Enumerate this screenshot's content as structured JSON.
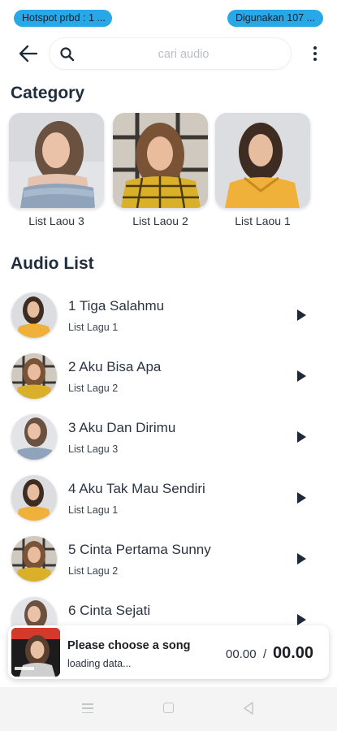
{
  "status": {
    "hotspot_text": "Hotspot prbd : 1 ...",
    "usage_text": "Digunakan 107 ..."
  },
  "header": {
    "back_icon": "arrow-left-icon",
    "search_icon": "search-icon",
    "search_placeholder": "cari audio",
    "search_value": "",
    "menu_icon": "more-vertical-icon"
  },
  "category": {
    "title": "Category",
    "items": [
      {
        "label": "List Laou 3"
      },
      {
        "label": "List Laou 2"
      },
      {
        "label": "List Laou 1"
      }
    ]
  },
  "audio_list": {
    "title": "Audio List",
    "items": [
      {
        "title": "1 Tiga Salahmu",
        "subtitle": "List Lagu 1"
      },
      {
        "title": "2 Aku Bisa Apa",
        "subtitle": "List Lagu 2"
      },
      {
        "title": "3 Aku Dan Dirimu",
        "subtitle": "List Lagu 3"
      },
      {
        "title": "4 Aku Tak Mau Sendiri",
        "subtitle": "List Lagu 1"
      },
      {
        "title": "5 Cinta Pertama Sunny",
        "subtitle": "List Lagu 2"
      },
      {
        "title": "6 Cinta Sejati",
        "subtitle": ""
      }
    ]
  },
  "player": {
    "title": "Please choose a song",
    "status": "loading data...",
    "current_time": "00.00",
    "separator": "/",
    "duration": "00.00"
  },
  "colors": {
    "accent_pill": "#29a8e8",
    "text_primary": "#1e2a38",
    "nav_bar": "#f4f4f5"
  }
}
